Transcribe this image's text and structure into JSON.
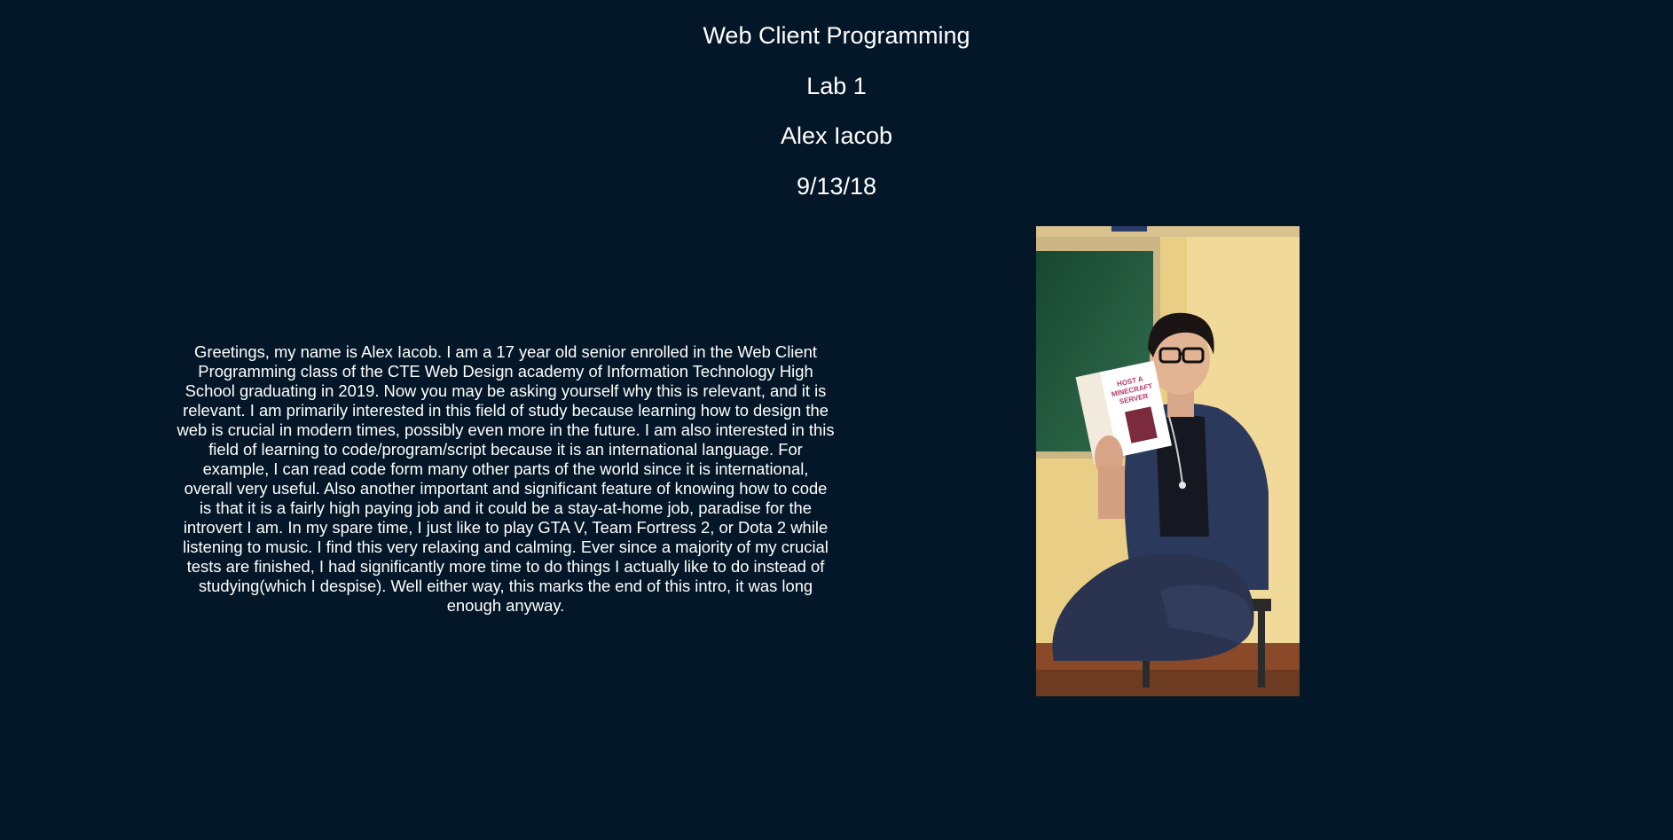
{
  "header": {
    "course": "Web Client Programming",
    "lab": "Lab 1",
    "author": "Alex Iacob",
    "date": "9/13/18"
  },
  "intro": {
    "text": "Greetings, my name is Alex Iacob. I am a 17 year old senior enrolled in the Web Client Programming class of the CTE Web Design academy of Information Technology High School graduating in 2019. Now you may be asking yourself why this is relevant, and it is relevant. I am primarily interested in this field of study because learning how to design the web is crucial in modern times, possibly even more in the future. I am also interested in this field of learning to code/program/script because it is an international language. For example, I can read code form many other parts of the world since it is international, overall very useful. Also another important and significant feature of knowing how to code is that it is a fairly high paying job and it could be a stay-at-home job, paradise for the introvert I am. In my spare time, I just like to play GTA V, Team Fortress 2, or Dota 2 while listening to music. I find this very relaxing and calming. Ever since a majority of my crucial tests are finished, I had significantly more time to do things I actually like to do instead of studying(which I despise). Well either way, this marks the end of this intro, it was long enough anyway."
  },
  "photo": {
    "book_title_line1": "HOST A",
    "book_title_line2": "MINECRAFT",
    "book_title_line3": "SERVER"
  },
  "colors": {
    "background": "#041728",
    "text": "#ffffff"
  }
}
